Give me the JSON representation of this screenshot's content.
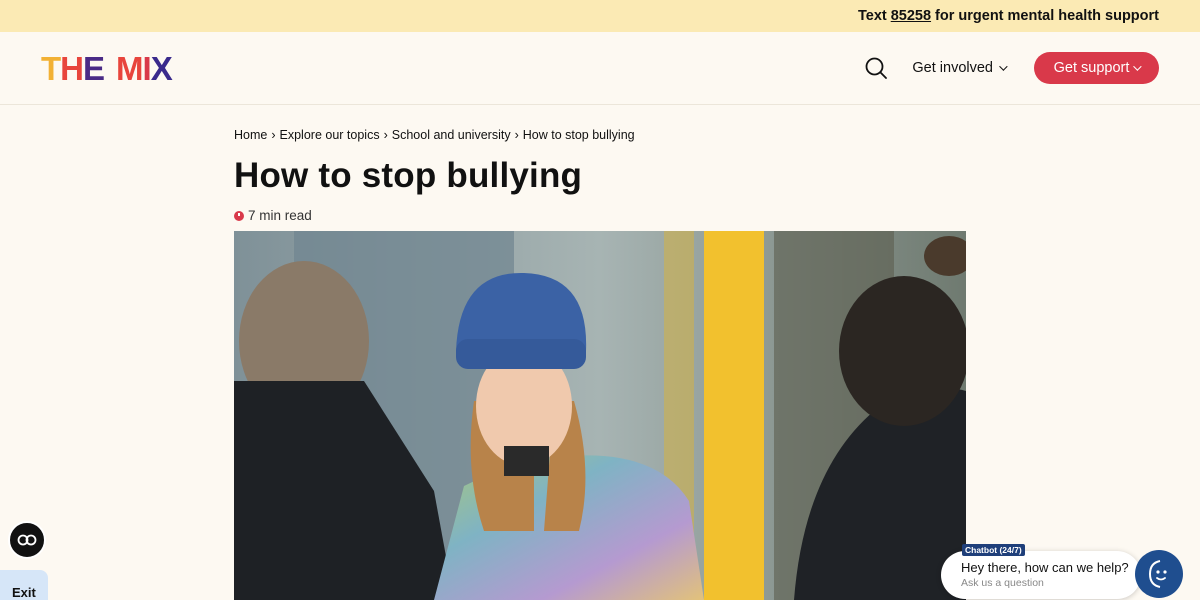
{
  "banner": {
    "prefix": "Text",
    "number": "85258",
    "suffix": "for urgent mental health support"
  },
  "logo": {
    "letters": [
      "T",
      "H",
      "E",
      "M",
      "I",
      "X"
    ],
    "colors": [
      "#f2b134",
      "#e8453c",
      "#4a2a86",
      "#e8453c",
      "#d9394a",
      "#3a2a8c"
    ]
  },
  "nav": {
    "get_involved": "Get involved",
    "get_support": "Get support"
  },
  "breadcrumb": [
    "Home",
    "Explore our topics",
    "School and university",
    "How to stop bullying"
  ],
  "breadcrumb_separator": "›",
  "article": {
    "title": "How to stop bullying",
    "read_time": "7 min read"
  },
  "hero_image": {
    "alt": "Young woman in a blue beanie and multicoloured jumper standing among people outdoors"
  },
  "accessibility": {
    "cc_icon": "cc-icon",
    "exit_label": "Exit"
  },
  "chatbot": {
    "tag": "Chatbot (24/7)",
    "greeting": "Hey there, how can we help?",
    "sub": "Ask us a question"
  },
  "colors": {
    "banner_bg": "#fbeab4",
    "page_bg": "#fdf9f2",
    "accent_red": "#d9394a",
    "chat_blue": "#1f4e8f"
  }
}
